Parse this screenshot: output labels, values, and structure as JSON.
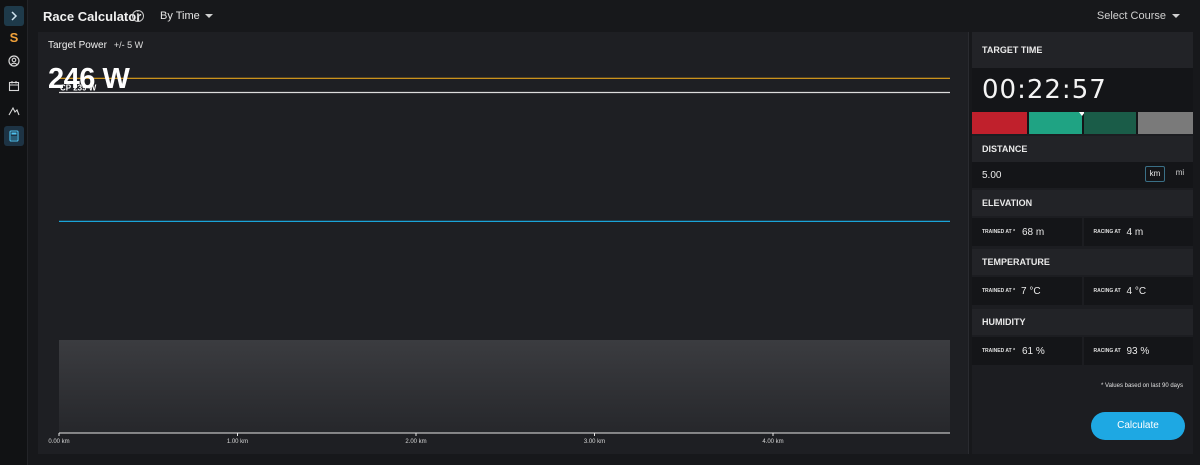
{
  "app": {
    "title": "Race Calculator",
    "mode": "By Time",
    "course_select": "Select Course",
    "brand_letter": "S"
  },
  "rail": {
    "icons": [
      "expand-icon",
      "brand-icon",
      "user-icon",
      "calendar-icon",
      "route-icon",
      "calculator-icon"
    ],
    "active": "calculator-icon"
  },
  "target_power": {
    "label": "Target Power",
    "tolerance": "+/- 5 W",
    "value": "246 W"
  },
  "chart_data": {
    "type": "line",
    "cp_label": "CP 239 W",
    "x_ticks": [
      "0.00 km",
      "1.00 km",
      "2.00 km",
      "3.00 km",
      "4.00 km"
    ],
    "x_tick_values": [
      0,
      1,
      2,
      3,
      4
    ],
    "xlim": [
      0,
      5
    ],
    "series": [
      {
        "name": "target",
        "color": "#e3a31c",
        "values": [
          246,
          246
        ]
      },
      {
        "name": "CP 239 W",
        "color": "#dcdcdc",
        "values": [
          239,
          239
        ]
      },
      {
        "name": "",
        "color": "#1aa4d8",
        "values": [
          175,
          175
        ]
      }
    ],
    "ylim": [
      70,
      269
    ],
    "elevation_fill": "#3a3b3f"
  },
  "side": {
    "target_time_label": "TARGET TIME",
    "time": "00:22:57",
    "zones": [
      {
        "color": "#c0202c"
      },
      {
        "color": "#1fa383"
      },
      {
        "color": "#1a5c48"
      },
      {
        "color": "#7a7a7a"
      }
    ],
    "marker_zone_fraction": 1.0,
    "distance_label": "DISTANCE",
    "distance": "5.00",
    "unit_km": "km",
    "unit_mi": "mi",
    "elevation_label": "ELEVATION",
    "elevation_trained_label": "TRAINED AT *",
    "elevation_trained": "68  m",
    "elevation_racing_label": "RACING AT",
    "elevation_racing": "4  m",
    "temperature_label": "TEMPERATURE",
    "temp_trained_label": "TRAINED AT *",
    "temp_trained": "7  °C",
    "temp_racing_label": "RACING AT",
    "temp_racing": "4  °C",
    "humidity_label": "HUMIDITY",
    "hum_trained_label": "TRAINED AT *",
    "hum_trained": "61  %",
    "hum_racing_label": "RACING AT",
    "hum_racing": "93  %",
    "footnote": "* Values based on last 90 days",
    "calculate_label": "Calculate"
  }
}
